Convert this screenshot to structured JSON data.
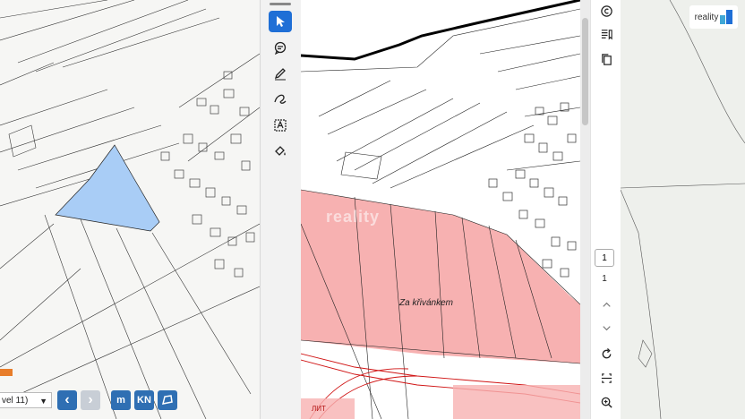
{
  "left_map": {
    "zoom_label": "vel 11)",
    "buttons": {
      "prev": "‹",
      "next": "›",
      "m_label": "m",
      "kn_label": "KN"
    },
    "highlight_color": "#a9cdf6"
  },
  "doc_viewer": {
    "area_label": "Za křivánkem",
    "watermark": "reality",
    "highlight_color": "#f7b1b1",
    "bottom_fragment": "ЛИТ"
  },
  "pagination": {
    "current_page": "1",
    "total_pages": "1"
  },
  "brand": {
    "logo_text": "reality",
    "accent": "#1f6fd6"
  },
  "icons": {
    "left_toolbar": [
      "cursor-icon",
      "comment-icon",
      "pen-icon",
      "freehand-icon",
      "text-box-icon",
      "fill-icon"
    ],
    "right_toolbar": [
      "copyright-icon",
      "bookmark-list-icon",
      "copy-pages-icon",
      "chevron-up-icon",
      "chevron-down-icon",
      "rotate-icon",
      "fit-page-icon",
      "zoom-in-icon"
    ]
  }
}
